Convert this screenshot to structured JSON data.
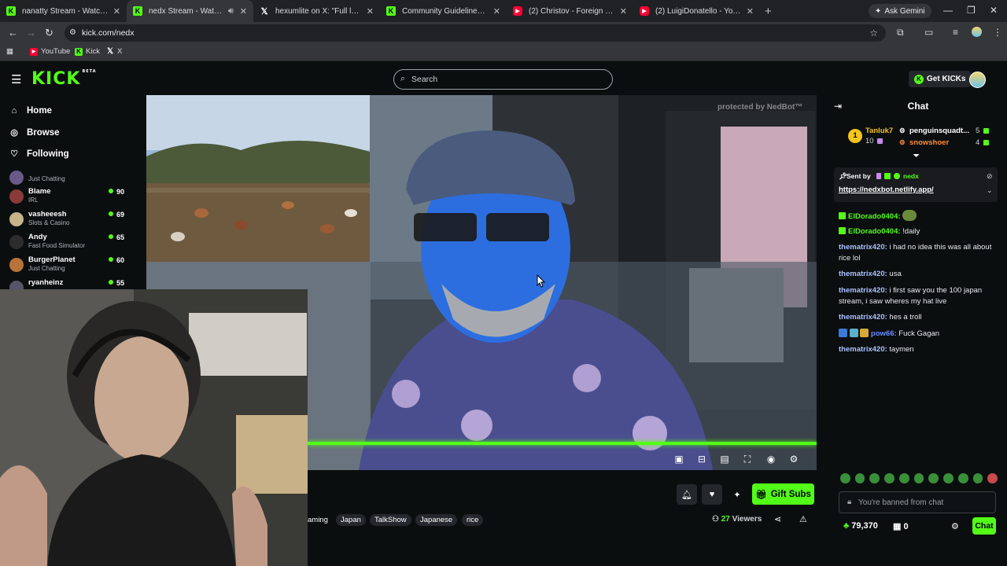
{
  "browser": {
    "tabs": [
      {
        "title": "nanatty Stream - Watch Live o",
        "icon": "kick-icon",
        "active": false
      },
      {
        "title": "nedx Stream - Watch Live o",
        "icon": "kick-icon",
        "active": true
      },
      {
        "title": "hexumlite on X: \"Full leadup an",
        "icon": "x-icon",
        "active": false
      },
      {
        "title": "Community Guidelines - Kick S",
        "icon": "kick-icon",
        "active": false
      },
      {
        "title": "(2) Christov - Foreign (iamMAN",
        "icon": "youtube-icon",
        "active": false
      },
      {
        "title": "(2) LuigiDonatello - YouTube",
        "icon": "youtube-icon",
        "active": false
      }
    ],
    "gemini_label": "Ask Gemini",
    "url": "kick.com/nedx",
    "bookmarks": [
      {
        "label": "YouTube",
        "icon": "youtube-icon"
      },
      {
        "label": "Kick",
        "icon": "kick-icon"
      },
      {
        "label": "X",
        "icon": "x-icon"
      }
    ]
  },
  "header": {
    "logo": "KICK",
    "logo_badge": "BETA",
    "search_placeholder": "Search",
    "get_kicks_label": "Get KICKs"
  },
  "sidebar": {
    "nav": [
      {
        "label": "Home",
        "icon": "home-icon"
      },
      {
        "label": "Browse",
        "icon": "compass-icon"
      },
      {
        "label": "Following",
        "icon": "heart-icon"
      }
    ],
    "channels": [
      {
        "name": "",
        "category": "Just Chatting",
        "viewers": ""
      },
      {
        "name": "Blame",
        "category": "IRL",
        "viewers": "90"
      },
      {
        "name": "vasheeesh",
        "category": "Slots & Casino",
        "viewers": "69"
      },
      {
        "name": "Andy",
        "category": "Fast Food Simulator",
        "viewers": "65"
      },
      {
        "name": "BurgerPlanet",
        "category": "Just Chatting",
        "viewers": "60"
      },
      {
        "name": "ryanheinz",
        "category": "",
        "viewers": "55"
      }
    ]
  },
  "player": {
    "watermark": "protected by NedBot™",
    "progress_fraction": 1.0
  },
  "stream_info": {
    "gift_subs_label": "Gift Subs",
    "tags": [
      "aming",
      "Japan",
      "TalkShow",
      "Japanese",
      "rice"
    ],
    "viewers_count": "27",
    "viewers_label": "Viewers"
  },
  "chat": {
    "title": "Chat",
    "leaderboard": [
      {
        "rank": "1",
        "name": "Tanluk7",
        "count": "10"
      },
      {
        "name": "penguinsquadt...",
        "count": "5"
      },
      {
        "name": "snowshoer",
        "count": "4"
      }
    ],
    "pinned": {
      "sent_by_label": "Sent by",
      "sender": "nedx",
      "link": "https://nedxbot.netlify.app/"
    },
    "messages": [
      {
        "user": "ElDorado0404:",
        "text": "",
        "color": "#53fc18"
      },
      {
        "user": "ElDorado0404:",
        "text": "!daily",
        "color": "#53fc18"
      },
      {
        "user": "thematrix420:",
        "text": "i had no idea this was all about rice lol",
        "color": "#a9c1ff"
      },
      {
        "user": "thematrix420:",
        "text": "usa",
        "color": "#a9c1ff"
      },
      {
        "user": "thematrix420:",
        "text": "i first saw you the 100 japan stream, i saw wheres my hat live",
        "color": "#a9c1ff"
      },
      {
        "user": "thematrix420:",
        "text": "hes a troll",
        "color": "#a9c1ff"
      },
      {
        "user": "pow66:",
        "text": "Fuck Gagan",
        "color": "#6a8cff"
      },
      {
        "user": "thematrix420:",
        "text": "taymen",
        "color": "#a9c1ff"
      }
    ],
    "input_placeholder": "You're banned from chat",
    "kicks_count": "79,370",
    "store_count": "0",
    "send_label": "Chat"
  },
  "colors": {
    "brand": "#53fc18",
    "bg": "#0b0e0f",
    "surface": "#24272c"
  }
}
